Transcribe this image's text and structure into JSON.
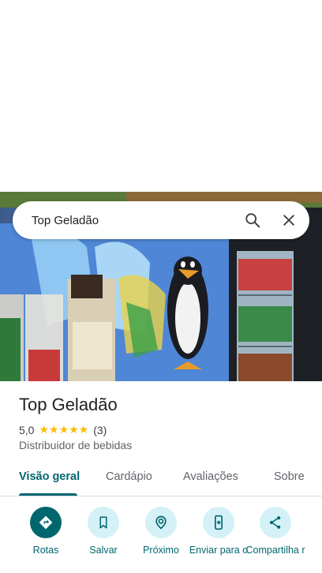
{
  "search": {
    "query": "Top Geladão"
  },
  "place": {
    "name": "Top Geladão",
    "rating": "5,0",
    "stars": "★★★★★",
    "review_count": "(3)",
    "category": "Distribuidor de bebidas"
  },
  "tabs": [
    {
      "label": "Visão geral"
    },
    {
      "label": "Cardápio"
    },
    {
      "label": "Avaliações"
    },
    {
      "label": "Sobre"
    }
  ],
  "actions": [
    {
      "label": "Rotas",
      "icon": "directions-icon"
    },
    {
      "label": "Salvar",
      "icon": "bookmark-icon"
    },
    {
      "label": "Próximo",
      "icon": "nearby-icon"
    },
    {
      "label": "Enviar para o",
      "icon": "send-to-phone-icon"
    },
    {
      "label": "Compartilha r",
      "icon": "share-icon"
    }
  ],
  "colors": {
    "accent": "#00666e",
    "accent_light": "#d3f1f7",
    "star": "#fbbc04"
  }
}
